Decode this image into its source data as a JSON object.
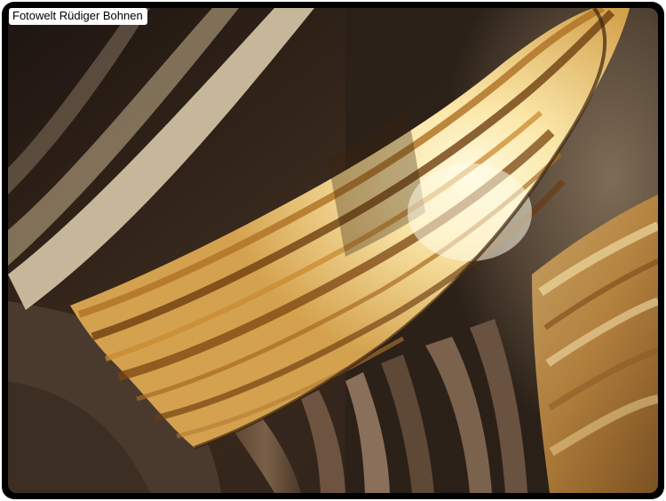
{
  "watermark": {
    "text": "Fotowelt Rüdiger Bohnen"
  },
  "photo": {
    "subject": "cave-flowstone-drapery",
    "colors": {
      "frame": "#000000",
      "rock_dark": "#2a1d14",
      "rock_mid": "#5a4632",
      "band_light": "#f4dca0",
      "band_glow": "#fff6cf",
      "band_brown": "#7a4a12",
      "band_amber": "#c9892a"
    }
  }
}
